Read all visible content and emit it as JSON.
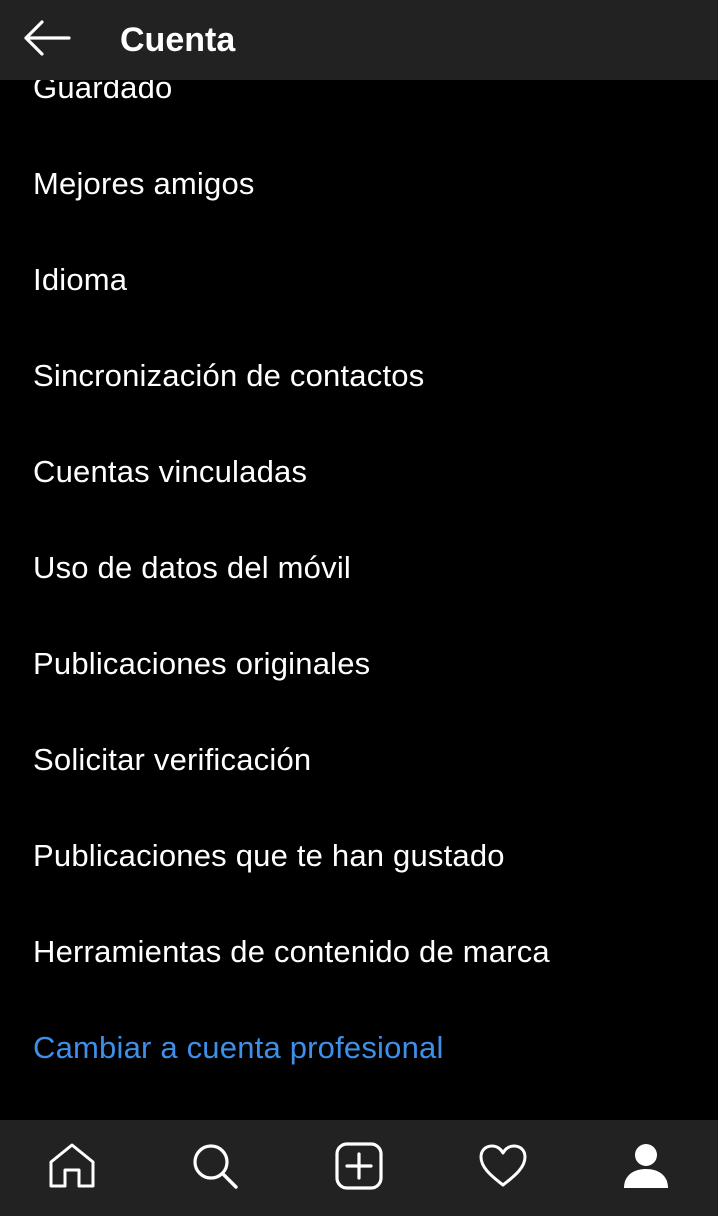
{
  "header": {
    "title": "Cuenta",
    "back_icon": "arrow-left-icon"
  },
  "menu": {
    "items": [
      {
        "label": "Guardado"
      },
      {
        "label": "Mejores amigos"
      },
      {
        "label": "Idioma"
      },
      {
        "label": "Sincronización de contactos"
      },
      {
        "label": "Cuentas vinculadas"
      },
      {
        "label": "Uso de datos del móvil"
      },
      {
        "label": "Publicaciones originales"
      },
      {
        "label": "Solicitar verificación"
      },
      {
        "label": "Publicaciones que te han gustado"
      },
      {
        "label": "Herramientas de contenido de marca"
      },
      {
        "label": "Cambiar a cuenta profesional"
      }
    ]
  },
  "bottom_nav": {
    "icons": [
      "home-icon",
      "search-icon",
      "add-post-icon",
      "heart-icon",
      "profile-icon"
    ]
  },
  "colors": {
    "background": "#000000",
    "bar": "#222222",
    "text": "#ffffff",
    "accent": "#3d8fe8"
  }
}
